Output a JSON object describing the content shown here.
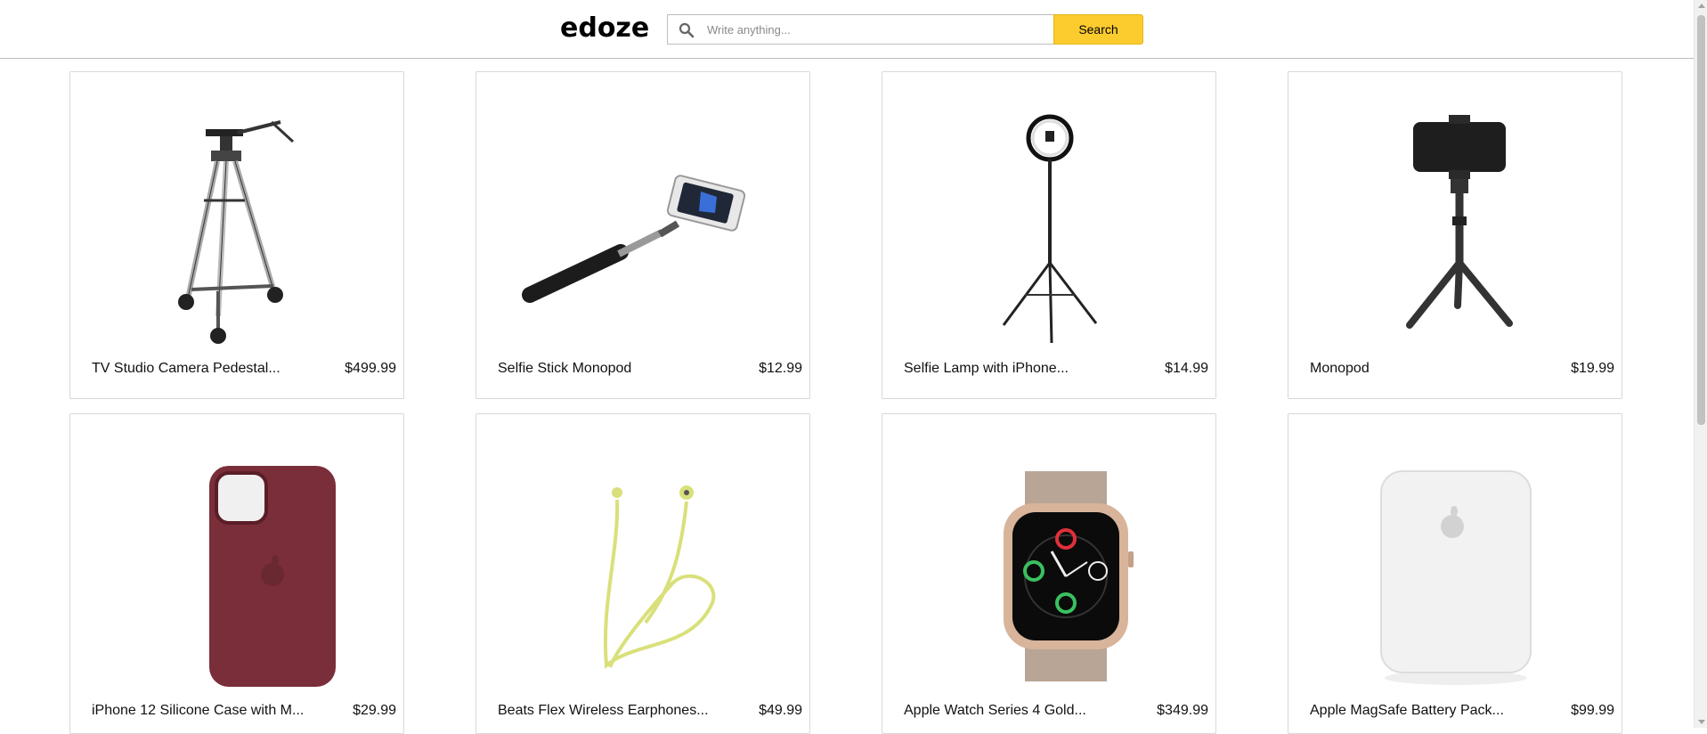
{
  "header": {
    "logo": "edoze",
    "search_placeholder": "Write anything...",
    "search_button": "Search"
  },
  "products": [
    {
      "name": "TV Studio Camera Pedestal...",
      "price": "$499.99",
      "icon": "tripod-image"
    },
    {
      "name": "Selfie Stick Monopod",
      "price": "$12.99",
      "icon": "selfie-stick-image"
    },
    {
      "name": "Selfie Lamp with iPhone...",
      "price": "$14.99",
      "icon": "ring-light-image"
    },
    {
      "name": "Monopod",
      "price": "$19.99",
      "icon": "monopod-image"
    },
    {
      "name": "iPhone 12 Silicone Case with M...",
      "price": "$29.99",
      "icon": "phone-case-image"
    },
    {
      "name": "Beats Flex Wireless Earphones...",
      "price": "$49.99",
      "icon": "earphones-image"
    },
    {
      "name": "Apple Watch Series 4 Gold...",
      "price": "$349.99",
      "icon": "watch-image"
    },
    {
      "name": "Apple MagSafe Battery Pack...",
      "price": "$99.99",
      "icon": "battery-pack-image"
    }
  ],
  "colors": {
    "accent": "#fccc2f",
    "case": "#7a2e3a",
    "earphones": "#d9e07a",
    "watch_band": "#b9a596"
  }
}
